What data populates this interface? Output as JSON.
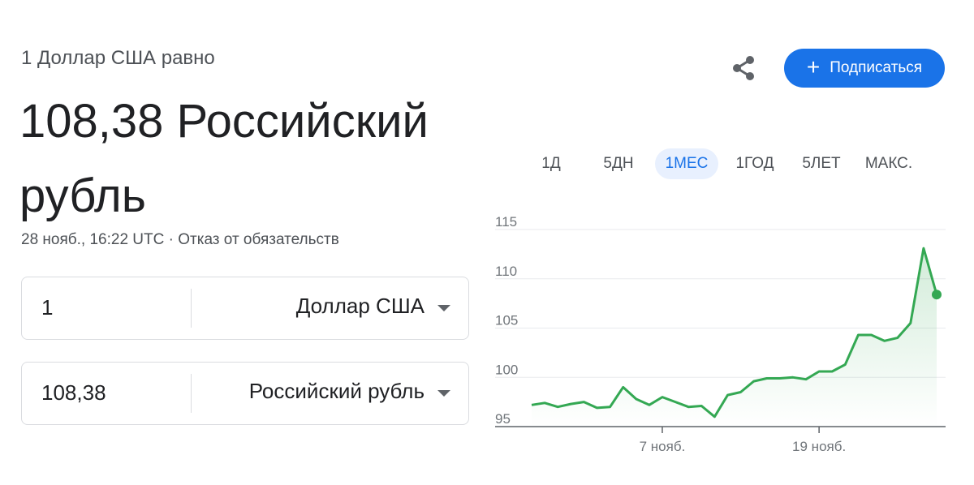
{
  "header": {
    "equal_label": "1 Доллар США равно",
    "big_value": "108,38 Российский рубль",
    "timestamp": "28 нояб., 16:22 UTC · Отказ от обязательств"
  },
  "actions": {
    "share_icon": "share-icon",
    "subscribe_label": "Подписаться"
  },
  "converter": {
    "from_amount": "1",
    "from_currency": "Доллар США",
    "to_amount": "108,38",
    "to_currency": "Российский рубль"
  },
  "ranges": [
    "1Д",
    "5ДН",
    "1МЕС",
    "1ГОД",
    "5ЛЕТ",
    "МАКС."
  ],
  "active_range": "1МЕС",
  "colors": {
    "accent": "#1a73e8",
    "line": "#34a853",
    "text": "#202124",
    "muted": "#4d5156"
  },
  "chart_data": {
    "type": "area",
    "title": "",
    "xlabel": "",
    "ylabel": "",
    "ylim": [
      95,
      115
    ],
    "yticks": [
      95,
      100,
      105,
      110,
      115
    ],
    "x_tick_labels": [
      {
        "label": "7 нояб.",
        "index": 10
      },
      {
        "label": "19 нояб.",
        "index": 22
      }
    ],
    "grid": true,
    "series": [
      {
        "values": [
          97.2,
          97.4,
          97.0,
          97.3,
          97.5,
          96.9,
          97.0,
          99.0,
          97.8,
          97.2,
          98.0,
          97.5,
          97.0,
          97.1,
          96.0,
          98.2,
          98.5,
          99.6,
          99.9,
          99.9,
          100.0,
          99.8,
          100.6,
          100.6,
          101.3,
          104.3,
          104.3,
          103.7,
          104.0,
          105.5,
          113.1,
          108.4
        ]
      }
    ]
  }
}
